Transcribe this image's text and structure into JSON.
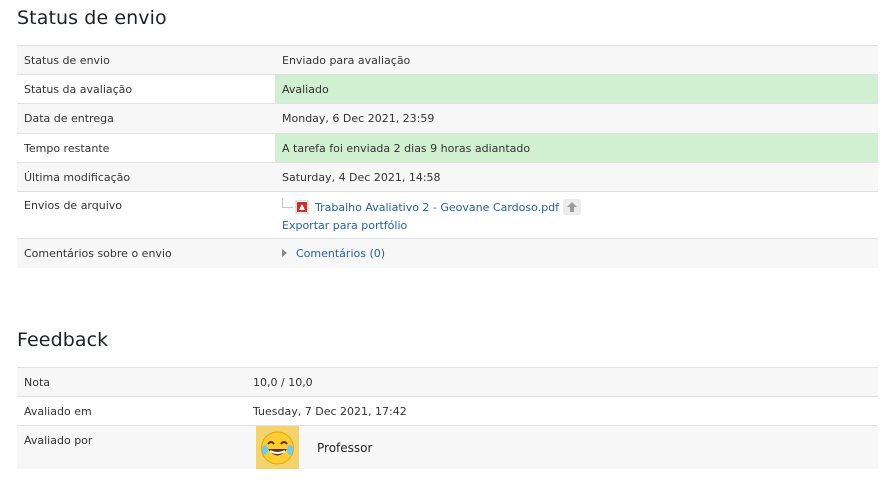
{
  "submission": {
    "title": "Status de envio",
    "rows": [
      {
        "label": "Status de envio",
        "value": "Enviado para avaliação"
      },
      {
        "label": "Status da avaliação",
        "value": "Avaliado"
      },
      {
        "label": "Data de entrega",
        "value": "Monday, 6 Dec 2021, 23:59"
      },
      {
        "label": "Tempo restante",
        "value": "A tarefa foi enviada 2 dias 9 horas adiantado"
      },
      {
        "label": "Última modificação",
        "value": "Saturday, 4 Dec 2021, 14:58"
      }
    ],
    "files": {
      "label": "Envios de arquivo",
      "filename": "Trabalho Avaliativo 2 - Geovane Cardoso.pdf",
      "export_label": "Exportar para portfólio"
    },
    "comments": {
      "label": "Comentários sobre o envio",
      "link": "Comentários (0)"
    },
    "highlight_color": "#d1efd1"
  },
  "feedback": {
    "title": "Feedback",
    "rows": [
      {
        "label": "Nota",
        "value": "10,0 / 10,0"
      },
      {
        "label": "Avaliado em",
        "value": "Tuesday, 7 Dec 2021, 17:42"
      }
    ],
    "grader": {
      "label": "Avaliado por",
      "name": "Professor",
      "avatar_icon": "laughing-emoji-icon"
    }
  },
  "link_color": "#2362a6"
}
